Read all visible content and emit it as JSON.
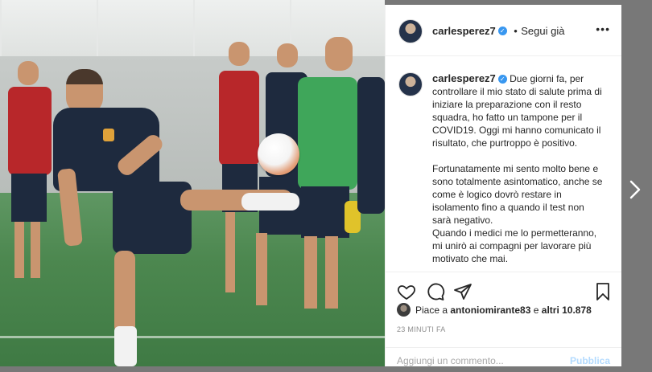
{
  "post": {
    "username": "carlesperez7",
    "verified_mark": "✓",
    "follow_label": "Segui già",
    "follow_separator": "•",
    "more_icon": "more-options-icon",
    "more_glyph": "•••"
  },
  "caption": {
    "username": "carlesperez7",
    "paragraph1": "Due giorni fa, per controllare il mio stato di salute prima di iniziare la preparazione con il resto squadra, ho fatto un tampone per il COVID19. Oggi mi hanno comunicato il risultato, che purtroppo è positivo.",
    "paragraph2": "Fortunatamente mi sento molto bene e sono totalmente asintomatico, anche se come è logico dovrò restare in isolamento fino a quando il test non sarà negativo.",
    "paragraph3": "Quando i medici me lo permetteranno, mi unirò ai compagni per lavorare più motivato che mai."
  },
  "actions": {
    "icons": [
      "heart-icon",
      "comment-icon",
      "share-icon",
      "bookmark-icon"
    ],
    "likes_prefix": "Piace a",
    "liker": "antoniomirante83",
    "likes_connector": "e",
    "likes_others": "altri 10.878",
    "timestamp": "23 MINUTI FA"
  },
  "comment": {
    "placeholder": "Aggiungi un commento...",
    "publish_label": "Pubblica"
  },
  "nav": {
    "next_icon": "chevron-right-icon"
  },
  "colors": {
    "verified_blue": "#3897f0",
    "publish_disabled": "#b3dbff",
    "overlay": "#787878"
  }
}
